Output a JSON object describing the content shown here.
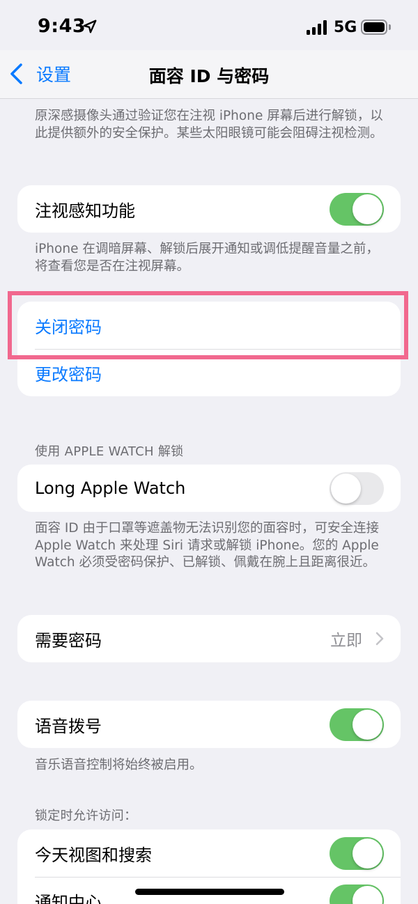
{
  "status_bar": {
    "time": "9:43",
    "network": "5G"
  },
  "nav": {
    "back_label": "设置",
    "title": "面容 ID 与密码"
  },
  "attention_footer": "原深感摄像头通过验证您在注视 iPhone 屏幕后进行解锁，以此提供额外的安全保护。某些太阳眼镜可能会阻碍注视检测。",
  "attention_aware": {
    "label": "注视感知功能",
    "enabled": true,
    "footer": "iPhone 在调暗屏幕、解锁后展开通知或调低提醒音量之前，将查看您是否在注视屏幕。"
  },
  "passcode": {
    "turn_off_label": "关闭密码",
    "change_label": "更改密码"
  },
  "watch_unlock": {
    "header": "使用 APPLE WATCH 解锁",
    "watch_name": "Long Apple Watch",
    "enabled": false,
    "footer": "面容 ID 由于口罩等遮盖物无法识别您的面容时，可安全连接 Apple Watch 来处理 Siri 请求或解锁 iPhone。您的 Apple Watch 必须受密码保护、已解锁、佩戴在腕上且距离很近。"
  },
  "require_passcode": {
    "label": "需要密码",
    "value": "立即"
  },
  "voice_dial": {
    "label": "语音拨号",
    "enabled": true,
    "footer": "音乐语音控制将始终被启用。"
  },
  "locked_access": {
    "header": "锁定时允许访问：",
    "items": [
      {
        "label": "今天视图和搜索",
        "enabled": true
      },
      {
        "label": "通知中心",
        "enabled": true
      }
    ]
  },
  "colors": {
    "accent": "#0a7aff",
    "toggle_on": "#65c466",
    "highlight": "#f1688e"
  }
}
